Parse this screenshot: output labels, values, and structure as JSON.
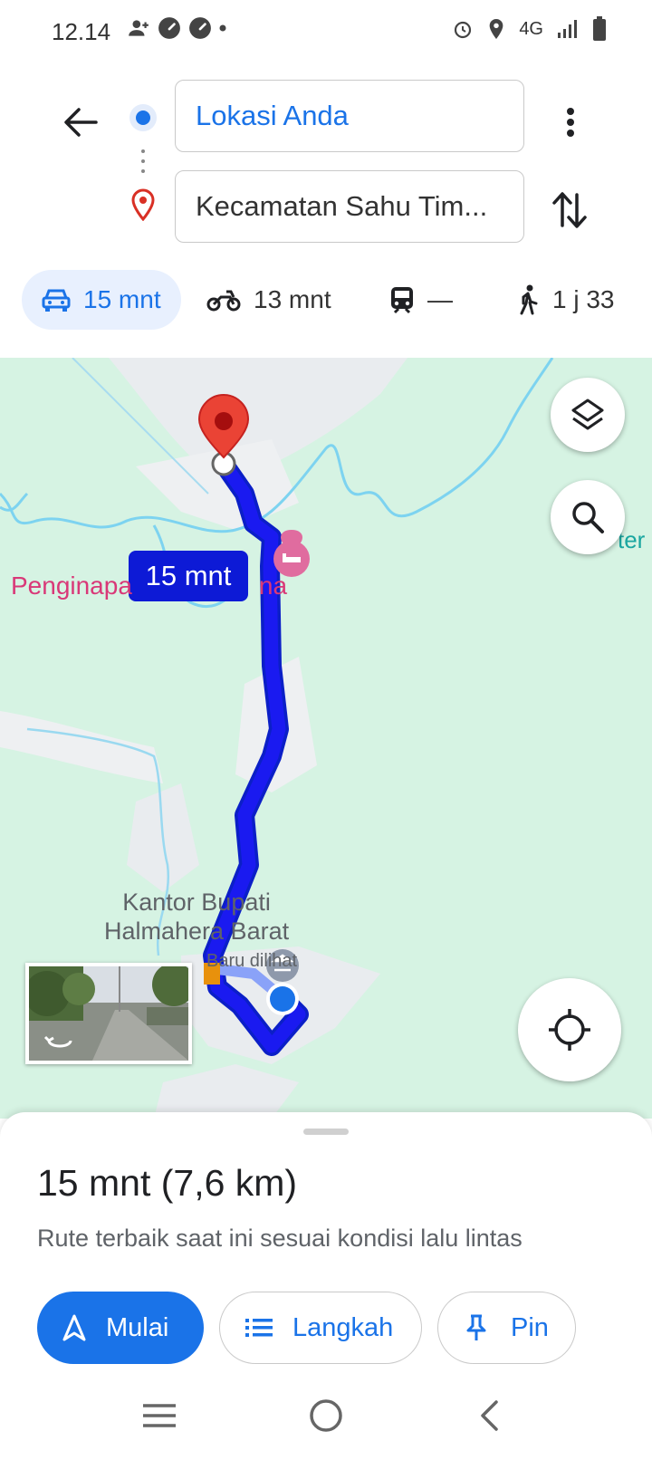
{
  "status_bar": {
    "time": "12.14",
    "network": "4G",
    "icons_left": [
      "person-add-icon",
      "speedometer-icon",
      "speedometer-icon",
      "dot-icon"
    ],
    "icons_right": [
      "alarm-icon",
      "location-icon",
      "signal-icon",
      "battery-icon"
    ]
  },
  "directions": {
    "origin": "Lokasi Anda",
    "destination": "Kecamatan Sahu Tim...",
    "modes": [
      {
        "name": "car",
        "label": "15 mnt",
        "selected": true
      },
      {
        "name": "motorcycle",
        "label": "13 mnt",
        "selected": false
      },
      {
        "name": "transit",
        "label": "—",
        "selected": false
      },
      {
        "name": "walk",
        "label": "1 j 33",
        "selected": false
      }
    ]
  },
  "map": {
    "route_time_bubble": "15 mnt",
    "place_label_inn_left": "Penginapa",
    "place_label_inn_right": "na",
    "place_label_edge": "ter",
    "place_label_office": "Kantor Bupati\nHalmahera Barat",
    "place_label_recent": "Baru dilihat",
    "colors": {
      "route": "#1a1af0",
      "land": "#d6f3e3",
      "water": "#7dd3f0",
      "pin": "#d93025"
    }
  },
  "sheet": {
    "title": "15 mnt (7,6 km)",
    "subtitle": "Rute terbaik saat ini sesuai kondisi lalu lintas",
    "start_label": "Mulai",
    "steps_label": "Langkah",
    "pin_label": "Pin"
  },
  "nav": [
    "recents-icon",
    "home-icon",
    "back-icon"
  ]
}
